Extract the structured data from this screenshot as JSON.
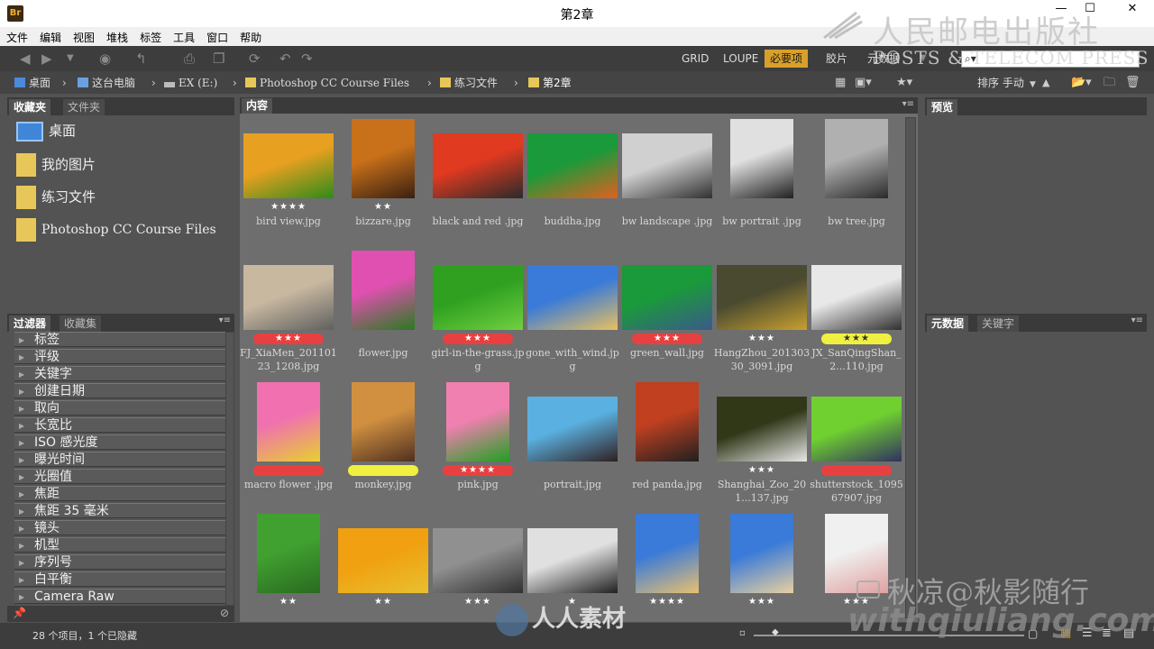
{
  "window": {
    "title": "第2章",
    "app_badge": "Br"
  },
  "menu": [
    "文件",
    "编辑",
    "视图",
    "堆栈",
    "标签",
    "工具",
    "窗口",
    "帮助"
  ],
  "workspaces": [
    "GRID",
    "LOUPE",
    "必要项",
    "胶片",
    "元数据"
  ],
  "active_workspace": "必要项",
  "path": [
    {
      "label": "桌面",
      "icon": "desktop-icon"
    },
    {
      "label": "这台电脑",
      "icon": "computer-icon"
    },
    {
      "label": "EX (E:)",
      "icon": "drive-icon"
    },
    {
      "label": "Photoshop CC Course Files",
      "icon": "folder-icon"
    },
    {
      "label": "练习文件",
      "icon": "folder-icon"
    },
    {
      "label": "第2章",
      "icon": "folder-icon"
    }
  ],
  "sort": {
    "label": "排序 手动"
  },
  "left_top_tabs": [
    "收藏夹",
    "文件夹"
  ],
  "favorites": [
    "桌面",
    "我的图片",
    "练习文件",
    "Photoshop CC Course Files"
  ],
  "left_bottom_tabs": [
    "过滤器",
    "收藏集"
  ],
  "filters": [
    "标签",
    "评级",
    "关键字",
    "创建日期",
    "取向",
    "长宽比",
    "ISO 感光度",
    "曝光时间",
    "光圈值",
    "焦距",
    "焦距 35 毫米",
    "镜头",
    "机型",
    "序列号",
    "白平衡",
    "Camera Raw"
  ],
  "content_tab": "内容",
  "preview_tab": "预览",
  "metadata_tabs": [
    "元数据",
    "关键字"
  ],
  "thumbnails": [
    {
      "name": "bird view.jpg",
      "rating": "★★★★",
      "label": "",
      "colors": [
        "#e8a020",
        "#2e8a1a"
      ]
    },
    {
      "name": "bizzare.jpg",
      "rating": "★★",
      "label": "",
      "colors": [
        "#c8701a",
        "#3a2010"
      ]
    },
    {
      "name": "black and red .jpg",
      "rating": "",
      "label": "",
      "colors": [
        "#e03a20",
        "#2a2a2a"
      ]
    },
    {
      "name": "buddha.jpg",
      "rating": "",
      "label": "",
      "colors": [
        "#1a9a3a",
        "#e06020"
      ]
    },
    {
      "name": "bw landscape .jpg",
      "rating": "",
      "label": "",
      "colors": [
        "#d0d0d0",
        "#303030"
      ]
    },
    {
      "name": "bw portrait .jpg",
      "rating": "",
      "label": "",
      "colors": [
        "#e0e0e0",
        "#202020"
      ]
    },
    {
      "name": "bw tree.jpg",
      "rating": "",
      "label": "",
      "colors": [
        "#b0b0b0",
        "#2a2a2a"
      ]
    },
    {
      "name": "FJ_XiaMen_20110123_1208.jpg",
      "rating": "★★★",
      "label": "red",
      "colors": [
        "#c8b8a0",
        "#606060"
      ]
    },
    {
      "name": "flower.jpg",
      "rating": "",
      "label": "",
      "colors": [
        "#e050b0",
        "#2a7a20"
      ]
    },
    {
      "name": "girl-in-the-grass.jpg",
      "rating": "★★★",
      "label": "red",
      "colors": [
        "#2fa020",
        "#70d040"
      ]
    },
    {
      "name": "gone_with_wind.jpg",
      "rating": "",
      "label": "",
      "colors": [
        "#3a7ad8",
        "#e8c060"
      ]
    },
    {
      "name": "green_wall.jpg",
      "rating": "★★★",
      "label": "red",
      "colors": [
        "#1a9a3a",
        "#3a5a8a"
      ]
    },
    {
      "name": "HangZhou_20130330_3091.jpg",
      "rating": "★★★",
      "label": "",
      "colors": [
        "#4a4a30",
        "#c8a030"
      ]
    },
    {
      "name": "JX_SanQingShan_2...110.jpg",
      "rating": "★★★",
      "label": "yellow",
      "colors": [
        "#e8e8e8",
        "#303030"
      ]
    },
    {
      "name": "macro flower .jpg",
      "rating": "",
      "label": "red",
      "colors": [
        "#f070b0",
        "#e8d030"
      ]
    },
    {
      "name": "monkey.jpg",
      "rating": "",
      "label": "yellow",
      "colors": [
        "#d09040",
        "#503020"
      ]
    },
    {
      "name": "pink.jpg",
      "rating": "★★★★",
      "label": "red",
      "colors": [
        "#f080b0",
        "#20a020"
      ]
    },
    {
      "name": "portrait.jpg",
      "rating": "",
      "label": "",
      "colors": [
        "#5ab0e0",
        "#302020"
      ]
    },
    {
      "name": "red panda.jpg",
      "rating": "",
      "label": "",
      "colors": [
        "#c04020",
        "#202020"
      ]
    },
    {
      "name": "Shanghai_Zoo_201...137.jpg",
      "rating": "★★★",
      "label": "",
      "colors": [
        "#303818",
        "#e8e8e8"
      ]
    },
    {
      "name": "shutterstock_109567907.jpg",
      "rating": "",
      "label": "red",
      "colors": [
        "#70d030",
        "#303060"
      ]
    },
    {
      "name": "",
      "rating": "★★",
      "label": "",
      "colors": [
        "#40a030",
        "#2a6a20"
      ]
    },
    {
      "name": "",
      "rating": "★★",
      "label": "",
      "colors": [
        "#f0a010",
        "#e8c030"
      ]
    },
    {
      "name": "",
      "rating": "★★★",
      "label": "",
      "colors": [
        "#909090",
        "#303030"
      ]
    },
    {
      "name": "",
      "rating": "★",
      "label": "",
      "colors": [
        "#e0e0e0",
        "#202020"
      ]
    },
    {
      "name": "",
      "rating": "★★★★",
      "label": "",
      "colors": [
        "#3a7ad8",
        "#e8c070"
      ]
    },
    {
      "name": "",
      "rating": "★★★",
      "label": "",
      "colors": [
        "#3a7ad8",
        "#e8d0a0"
      ]
    },
    {
      "name": "",
      "rating": "★★★",
      "label": "",
      "colors": [
        "#f0f0f0",
        "#e0a0a0"
      ]
    }
  ],
  "status": "28 个项目，1 个已隐藏",
  "watermarks": {
    "publisher_cn": "人民邮电出版社",
    "publisher_en": "POSTS & TELECOM PRESS",
    "author": "秋凉@秋影随行",
    "site": "withqiuliang.com",
    "logo_text": "人人素材"
  },
  "accent": "#d8a02a",
  "label_colors": {
    "red": "#e84040",
    "yellow": "#f0f040"
  }
}
